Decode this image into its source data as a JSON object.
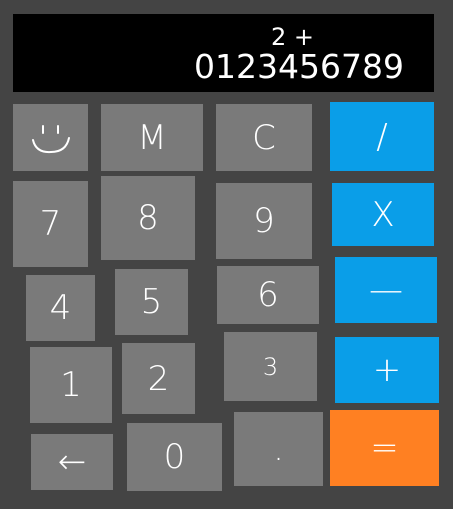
{
  "display": {
    "memo": "2 +",
    "value": "0123456789"
  },
  "keys": {
    "smile": "☺",
    "m": "M",
    "c": "C",
    "divide": "/",
    "seven": "7",
    "eight": "8",
    "nine": "9",
    "multiply": "X",
    "four": "4",
    "five": "5",
    "six": "6",
    "minus": "—",
    "one": "1",
    "two": "2",
    "three": "3",
    "plus": "+",
    "backspace": "←",
    "zero": "0",
    "dot": ".",
    "equals": "="
  },
  "colors": {
    "background": "#444444",
    "display": "#000000",
    "key": "#7a7a7a",
    "operator": "#0a9ee8",
    "equals": "#ff8022"
  }
}
